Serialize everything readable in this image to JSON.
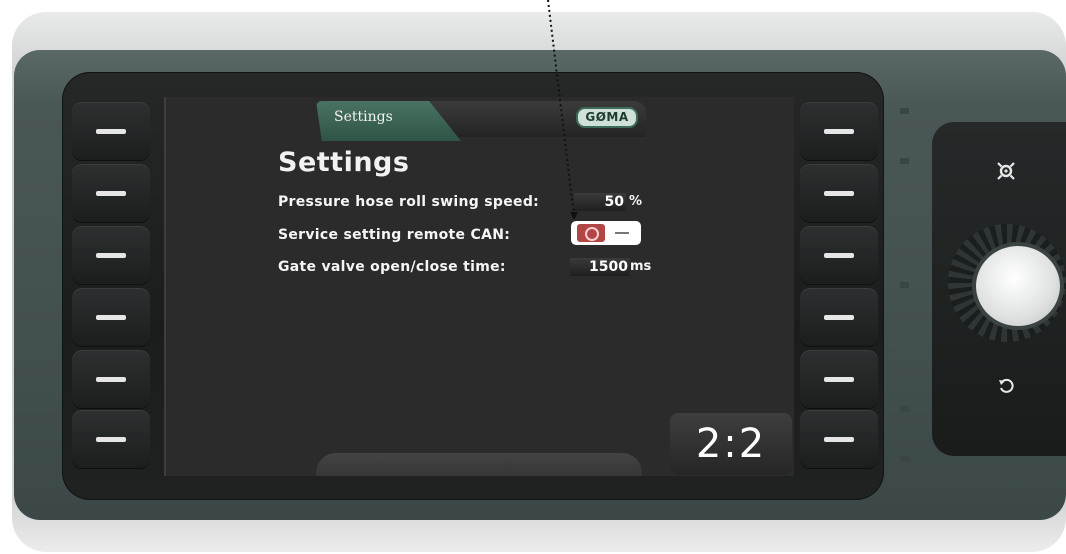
{
  "header": {
    "tab_label": "Settings",
    "logo_text": "GØMA"
  },
  "page": {
    "title": "Settings"
  },
  "settings": [
    {
      "label": "Pressure hose roll swing speed:",
      "value": "50",
      "unit": "%"
    },
    {
      "label": "Service setting remote CAN:",
      "toggle_state": "off"
    },
    {
      "label": "Gate valve open/close time:",
      "value": "1500",
      "unit": "ms"
    }
  ],
  "pager": {
    "text": "2:2"
  },
  "icons": {
    "right_top": "alarm-light-icon",
    "right_bottom": "back-icon"
  },
  "colors": {
    "tab_green": "#3e6656",
    "toggle_red": "#b24646",
    "screen_bg": "#2b2b2b"
  }
}
